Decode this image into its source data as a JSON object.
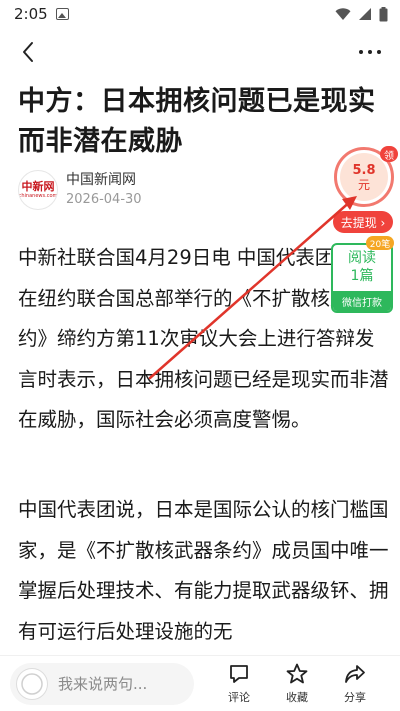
{
  "status_bar": {
    "time": "2:05"
  },
  "article": {
    "title": "中方：日本拥核问题已是现实而非潜在威胁",
    "source": {
      "name": "中国新闻网",
      "date": "2026-04-30",
      "logo_text": "中新网",
      "logo_sub": "chinanews.com"
    },
    "paragraphs": [
      "中新社联合国4月29日电 中国代表团29日在纽约联合国总部举行的《不扩散核武器条约》缔约方第11次审议大会上进行答辩发言时表示，日本拥核问题已经是现实而非潜在威胁，国际社会必须高度警惕。",
      "中国代表团说，日本是国际公认的核门槛国家，是《不扩散核武器条约》成员国中唯一掌握后处理技术、有能力提取武器级钚、拥有可运行后处理设施的无"
    ]
  },
  "reward_widget": {
    "amount": "5.8",
    "unit": "元",
    "badge": "领",
    "withdraw_label": "去提现 ›"
  },
  "read_task": {
    "badge": "20笔",
    "line1": "阅读",
    "line2": "1篇",
    "footer": "微信打款"
  },
  "bottom_bar": {
    "comment_placeholder": "我来说两句...",
    "comment_label": "评论",
    "favorite_label": "收藏",
    "share_label": "分享"
  },
  "colors": {
    "accent_red": "#f0433c",
    "accent_green": "#2eb85c",
    "arrow_red": "#e0352b"
  }
}
